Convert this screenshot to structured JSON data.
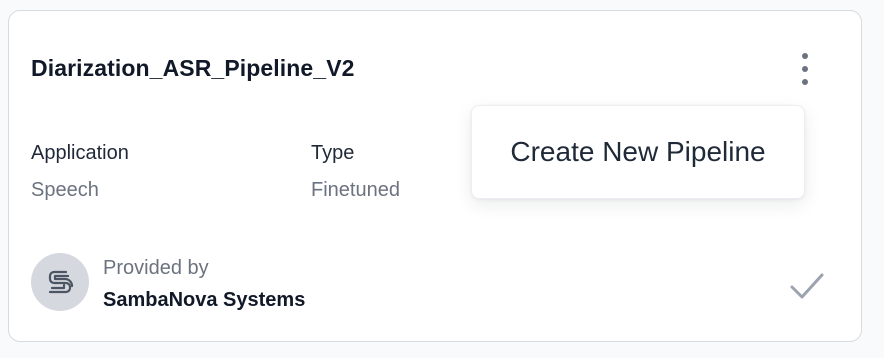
{
  "card": {
    "title": "Diarization_ASR_Pipeline_V2",
    "fields": [
      {
        "label": "Application",
        "value": "Speech"
      },
      {
        "label": "Type",
        "value": "Finetuned"
      }
    ],
    "provider": {
      "label": "Provided by",
      "name": "SambaNova Systems",
      "logo_icon": "sambanova-logo-icon"
    },
    "menu_icon": "kebab-menu-icon",
    "status_icon": "check-icon",
    "dropdown": {
      "items": [
        {
          "label": "Create New Pipeline"
        }
      ]
    }
  },
  "colors": {
    "title": "#111827",
    "label": "#1f2937",
    "muted": "#6b7280",
    "avatar_bg": "#d5d8de",
    "border": "#d7dbe0",
    "check": "#9ca3af"
  }
}
